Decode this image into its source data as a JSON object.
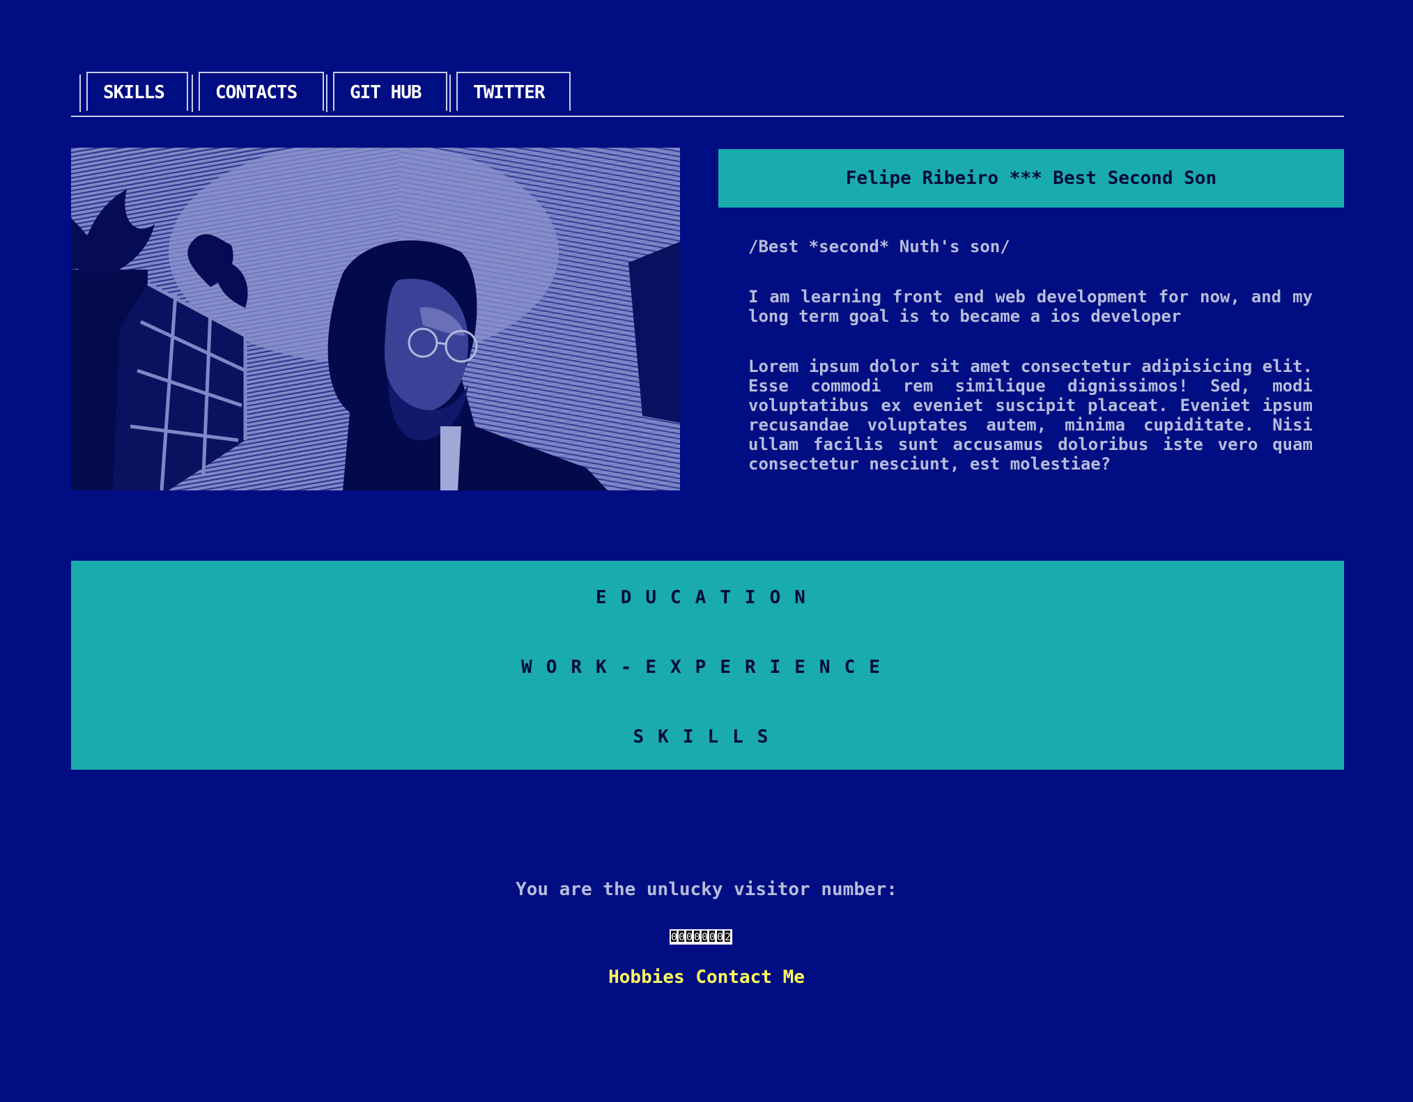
{
  "nav": {
    "tabs": [
      {
        "label": "SKILLS"
      },
      {
        "label": "CONTACTS"
      },
      {
        "label": "GIT HUB"
      },
      {
        "label": "TWITTER"
      }
    ]
  },
  "profile": {
    "title": "Felipe Ribeiro *** Best Second Son",
    "tagline": "/Best *second* Nuth's son/",
    "intro": "I am learning front end web development for now, and my long term goal is to became a ios developer",
    "body": "Lorem ipsum dolor sit amet consectetur adipisicing elit. Esse commodi rem similique dignissimos! Sed, modi voluptatibus ex eveniet suscipit placeat. Eveniet ipsum recusandae voluptates autem, minima cupiditate. Nisi ullam facilis sunt accusamus doloribus iste vero quam consectetur nesciunt, est molestiae?"
  },
  "sections": {
    "education": "EDUCATION",
    "work": "WORK-EXPERIENCE",
    "skills": "SKILLS"
  },
  "footer": {
    "visitor_text": "You are the unlucky visitor number:",
    "counter_digits": [
      "0",
      "0",
      "0",
      "0",
      "0",
      "0",
      "0",
      "2"
    ],
    "link_hobbies": "Hobbies",
    "link_contact": "Contact Me"
  },
  "colors": {
    "background": "#010d82",
    "teal": "#1aabac",
    "link_yellow": "#ffff5a"
  }
}
